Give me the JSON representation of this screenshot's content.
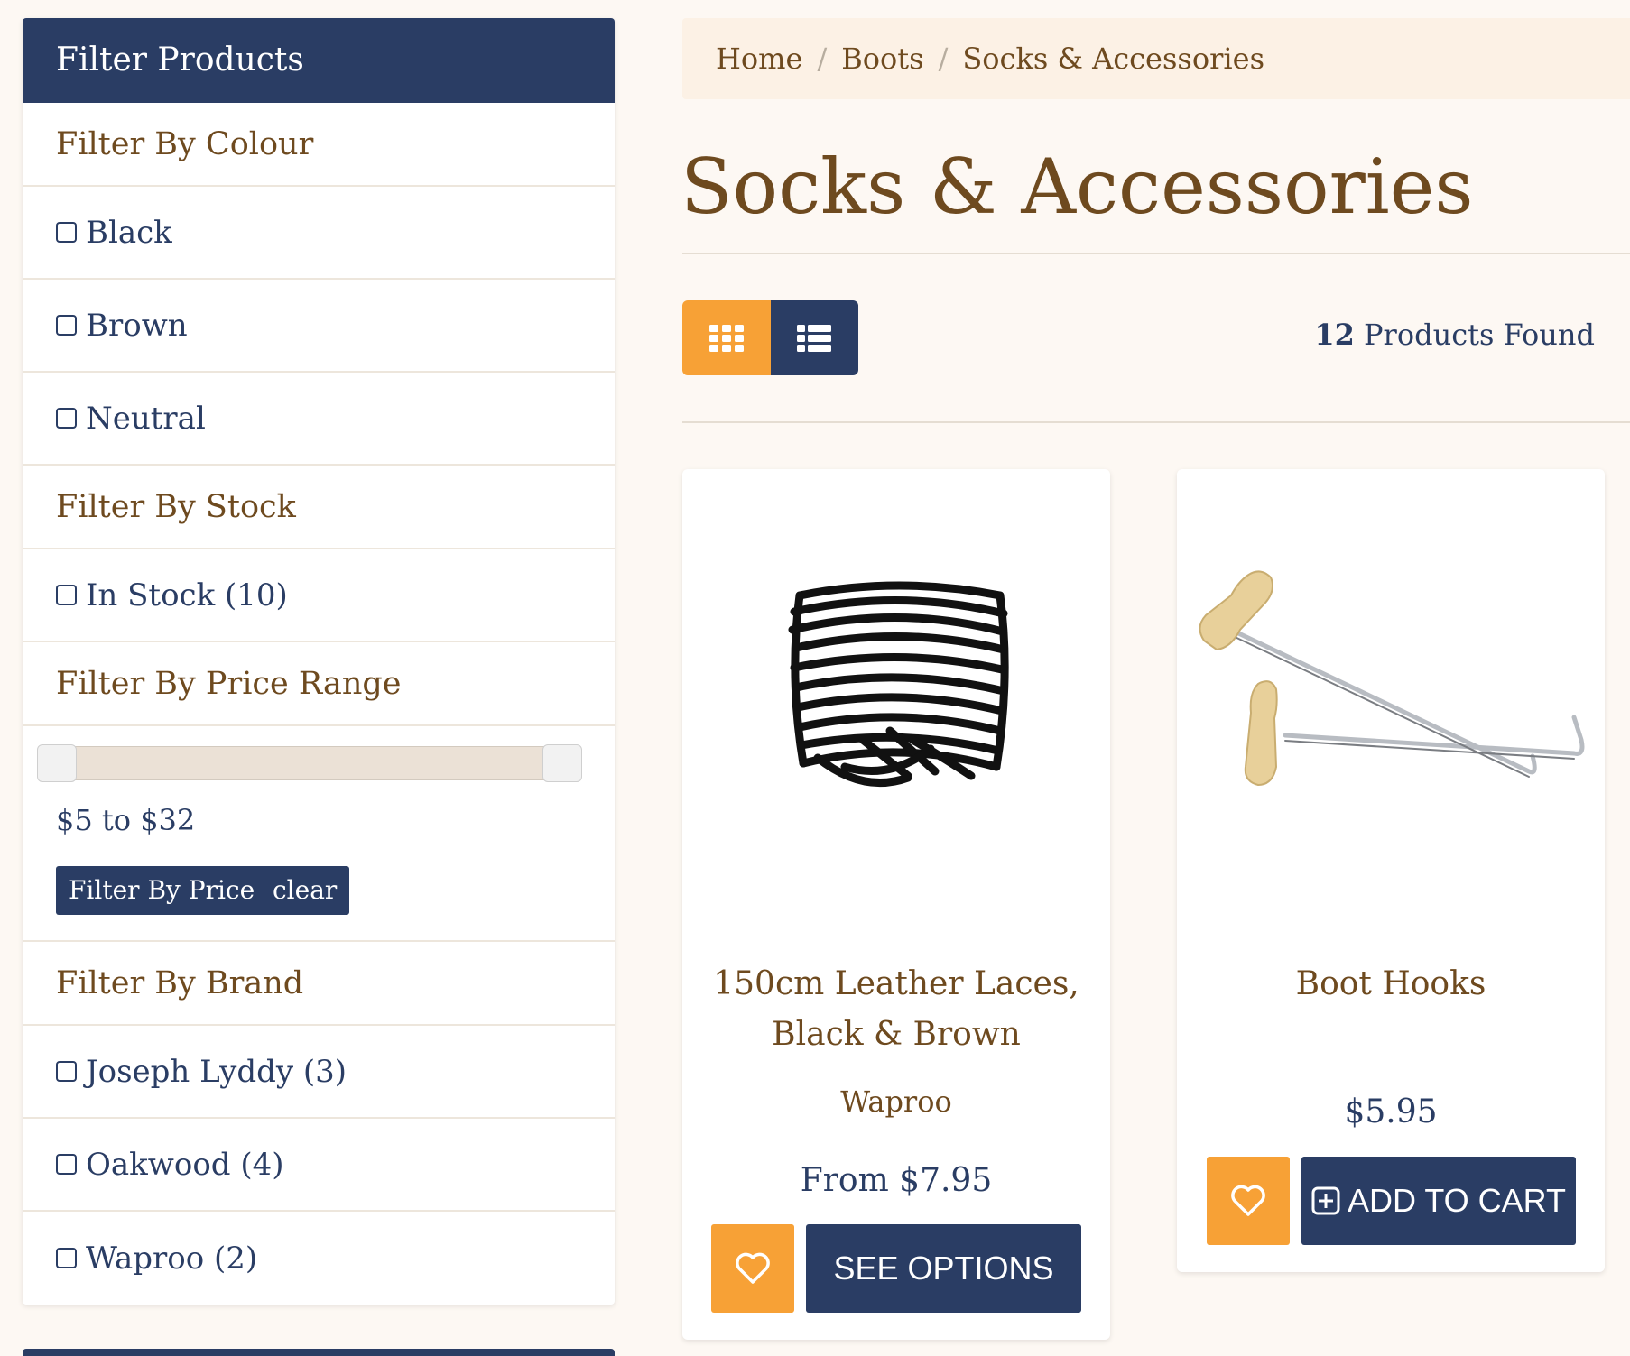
{
  "sidebar": {
    "title": "Filter Products",
    "colour": {
      "heading": "Filter By Colour",
      "options": [
        "Black",
        "Brown",
        "Neutral"
      ]
    },
    "stock": {
      "heading": "Filter By Stock",
      "options": [
        "In Stock (10)"
      ]
    },
    "price": {
      "heading": "Filter By Price Range",
      "range_text": "$5 to $32",
      "min": 5,
      "max": 32,
      "filter_button": "Filter By Price",
      "clear_button": "clear"
    },
    "brand": {
      "heading": "Filter By Brand",
      "options": [
        "Joseph Lyddy (3)",
        "Oakwood (4)",
        "Waproo (2)"
      ]
    }
  },
  "breadcrumb": [
    "Home",
    "Boots",
    "Socks & Accessories"
  ],
  "page_title": "Socks & Accessories",
  "products_found": {
    "count": "12",
    "label": "Products Found"
  },
  "products": [
    {
      "name": "150cm Leather Laces, Black & Brown",
      "brand": "Waproo",
      "price": "From $7.95",
      "action": "SEE OPTIONS",
      "image": "black-leather-laces"
    },
    {
      "name": "Boot Hooks",
      "brand": "",
      "price": "$5.95",
      "action": "ADD TO CART",
      "image": "boot-hooks"
    }
  ],
  "colors": {
    "navy": "#2a3d64",
    "orange": "#f7a136",
    "brown": "#6e4a1f",
    "background": "#fdf8f3"
  }
}
